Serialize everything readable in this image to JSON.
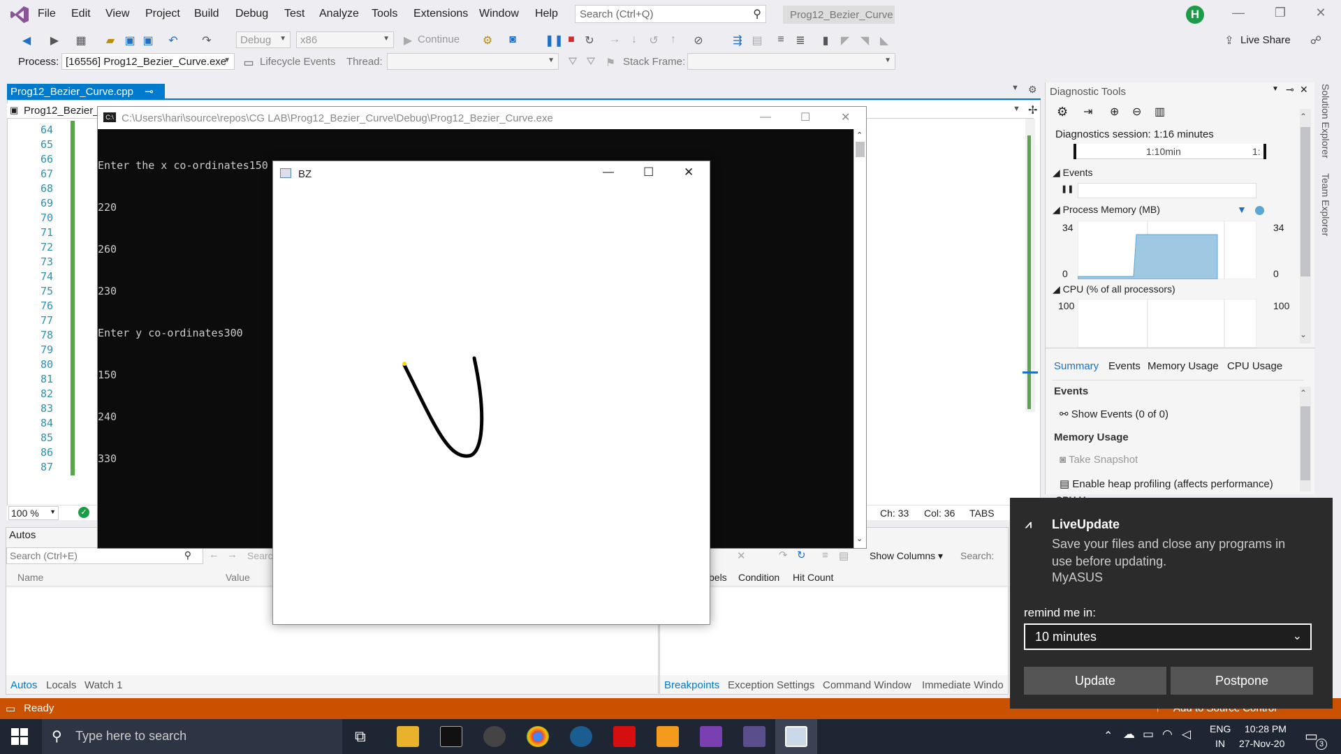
{
  "menu": [
    "File",
    "Edit",
    "View",
    "Project",
    "Build",
    "Debug",
    "Test",
    "Analyze",
    "Tools",
    "Extensions",
    "Window",
    "Help"
  ],
  "search": {
    "placeholder": "Search (Ctrl+Q)"
  },
  "solution_name": "Prog12_Bezier_Curve",
  "avatar_letter": "H",
  "live_share": "Live Share",
  "toolbar": {
    "config": "Debug",
    "platform": "x86",
    "continue_label": "Continue"
  },
  "debug_bar": {
    "process_label": "Process:",
    "process_value": "[16556] Prog12_Bezier_Curve.exe",
    "lifecycle_label": "Lifecycle Events",
    "thread_label": "Thread:",
    "stack_frame_label": "Stack Frame:"
  },
  "doc_tab": {
    "filename": "Prog12_Bezier_Curve.cpp",
    "nav_project": "Prog12_Bezier_C"
  },
  "line_numbers": [
    "64",
    "65",
    "66",
    "67",
    "68",
    "69",
    "70",
    "71",
    "72",
    "73",
    "74",
    "75",
    "76",
    "77",
    "78",
    "79",
    "80",
    "81",
    "82",
    "83",
    "84",
    "85",
    "86",
    "87"
  ],
  "editor_status": {
    "zoom": "100 %",
    "ch": "Ch: 33",
    "col": "Col: 36",
    "tabs": "TABS"
  },
  "console": {
    "title": "C:\\Users\\hari\\source\\repos\\CG LAB\\Prog12_Bezier_Curve\\Debug\\Prog12_Bezier_Curve.exe",
    "lines": [
      "Enter the x co-ordinates150",
      "220",
      "260",
      "230",
      "Enter y co-ordinates300",
      "150",
      "240",
      "330"
    ]
  },
  "bz_window": {
    "title": "BZ"
  },
  "autos": {
    "title": "Autos",
    "search_placeholder": "Search (Ctrl+E)",
    "search2": "Searc",
    "col_name": "Name",
    "col_value": "Value",
    "tabs": [
      "Autos",
      "Locals",
      "Watch 1"
    ]
  },
  "breakpoints": {
    "show_columns": "Show Columns",
    "search_label": "Search:",
    "col_labels": "bels",
    "col_condition": "Condition",
    "col_hit": "Hit Count",
    "tabs": [
      "Breakpoints",
      "Exception Settings",
      "Command Window",
      "Immediate Windo"
    ]
  },
  "diagnostics": {
    "title": "Diagnostic Tools",
    "session": "Diagnostics session: 1:16 minutes",
    "timeline_tick": "1:10min",
    "timeline_tick2": "1:",
    "events_label": "Events",
    "memory_label": "Process Memory (MB)",
    "memory_max": "34",
    "memory_min": "0",
    "cpu_label": "CPU (% of all processors)",
    "cpu_max": "100",
    "tabs": [
      "Summary",
      "Events",
      "Memory Usage",
      "CPU Usage"
    ],
    "sec_events": "Events",
    "show_events": "Show Events (0 of 0)",
    "sec_memory": "Memory Usage",
    "take_snapshot": "Take Snapshot",
    "heap_profiling": "Enable heap profiling (affects performance)",
    "cpu_cut": "CPU U"
  },
  "side_tabs": [
    "Solution Explorer",
    "Team Explorer"
  ],
  "status": {
    "ready": "Ready",
    "source_control": "Add to Source Control"
  },
  "notification": {
    "app_title": "LiveUpdate",
    "message": "Save your files and close any programs in use before updating.",
    "source": "MyASUS",
    "remind_label": "remind me in:",
    "remind_value": "10 minutes",
    "update_button": "Update",
    "postpone_button": "Postpone"
  },
  "taskbar": {
    "search_placeholder": "Type here to search",
    "lang1": "ENG",
    "lang2": "IN",
    "time": "10:28 PM",
    "date": "27-Nov-20",
    "notif_count": "3"
  },
  "colors": {
    "accent": "#007acc",
    "status_bar": "#ca5100",
    "memory_fill": "#9fc9e2",
    "notify_bg": "#2b2b2b"
  }
}
